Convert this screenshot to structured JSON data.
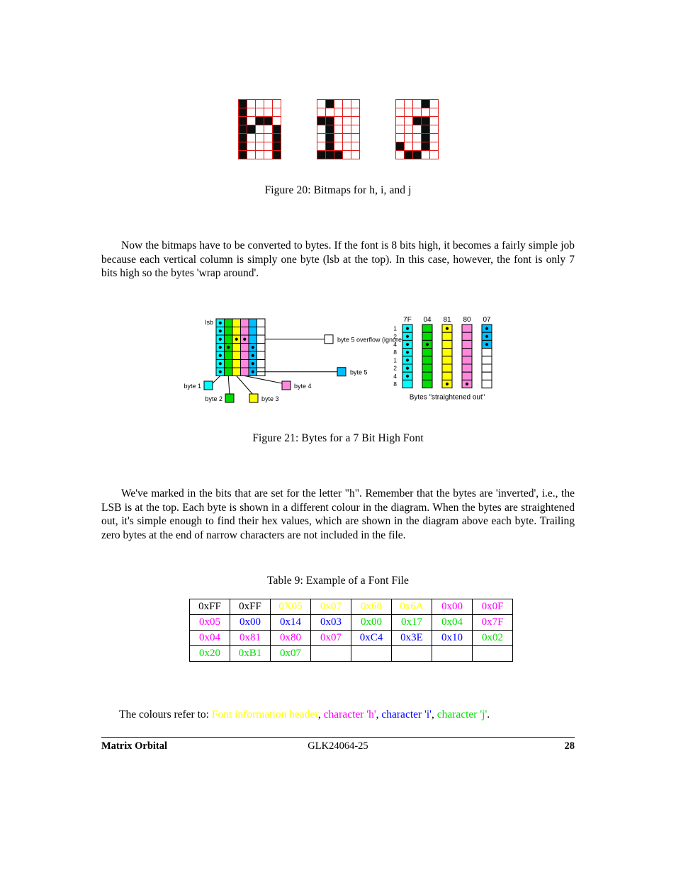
{
  "figure20": {
    "caption": "Figure 20: Bitmaps for h, i, and j",
    "grid_color": "#e01b1b",
    "on_color": "#0d0d0d",
    "bitmaps": [
      {
        "char": "h",
        "cols": 5,
        "rows": 7,
        "pixels": [
          [
            1,
            0,
            0,
            0,
            0
          ],
          [
            1,
            0,
            0,
            0,
            0
          ],
          [
            1,
            0,
            1,
            1,
            0
          ],
          [
            1,
            1,
            0,
            0,
            1
          ],
          [
            1,
            0,
            0,
            0,
            1
          ],
          [
            1,
            0,
            0,
            0,
            1
          ],
          [
            1,
            0,
            0,
            0,
            1
          ]
        ]
      },
      {
        "char": "i",
        "cols": 5,
        "rows": 7,
        "pixels": [
          [
            0,
            1,
            0,
            0,
            0
          ],
          [
            0,
            0,
            0,
            0,
            0
          ],
          [
            1,
            1,
            0,
            0,
            0
          ],
          [
            0,
            1,
            0,
            0,
            0
          ],
          [
            0,
            1,
            0,
            0,
            0
          ],
          [
            0,
            1,
            0,
            0,
            0
          ],
          [
            1,
            1,
            1,
            0,
            0
          ]
        ]
      },
      {
        "char": "j",
        "cols": 5,
        "rows": 7,
        "pixels": [
          [
            0,
            0,
            0,
            1,
            0
          ],
          [
            0,
            0,
            0,
            0,
            0
          ],
          [
            0,
            0,
            1,
            1,
            0
          ],
          [
            0,
            0,
            0,
            1,
            0
          ],
          [
            0,
            0,
            0,
            1,
            0
          ],
          [
            1,
            0,
            0,
            1,
            0
          ],
          [
            0,
            1,
            1,
            0,
            0
          ]
        ]
      }
    ]
  },
  "paragraphs": {
    "p1": "Now the bitmaps have to be converted to bytes. If the font is 8 bits high, it becomes a fairly simple job because each vertical column is simply one byte (lsb at the top). In this case, however, the font is only 7 bits high so the bytes 'wrap around'.",
    "p2": "We've marked in the bits that are set for the letter \"h\". Remember that the bytes are 'inverted', i.e., the LSB is at the top. Each byte is shown in a different colour in the diagram. When the bytes are straightened out, it's simple enough to find their hex values, which are shown in the diagram above each byte. Trailing zero bytes at the end of narrow characters are not included in the file."
  },
  "figure21": {
    "caption": "Figure 21: Bytes for a 7 Bit High Font",
    "lsb_label": "lsb",
    "straightened_label": "Bytes \"straightened out\"",
    "byte_colors": {
      "byte1": "#00ffff",
      "byte2": "#00dd00",
      "byte3": "#ffff00",
      "byte4": "#ff88dd",
      "byte5": "#00bfff",
      "overflow": "#ffffff"
    },
    "legend": [
      {
        "label": "byte 5 overflow (ignored)",
        "color": "#ffffff"
      },
      {
        "label": "byte 5",
        "color": "#00bfff"
      },
      {
        "label": "byte 1",
        "color": "#00ffff"
      },
      {
        "label": "byte 2",
        "color": "#00dd00"
      },
      {
        "label": "byte 3",
        "color": "#ffff00"
      },
      {
        "label": "byte 4",
        "color": "#ff88dd"
      }
    ],
    "wrapped_grid": {
      "cols": 6,
      "rows": 7,
      "column_colors": [
        "#00ffff",
        "#00dd00",
        "#ffff00",
        "#ff88dd",
        "#00bfff",
        "#ffffff"
      ],
      "dots": [
        [
          1,
          0,
          0,
          0,
          0,
          0
        ],
        [
          1,
          0,
          0,
          0,
          0,
          0
        ],
        [
          1,
          0,
          1,
          1,
          0,
          0
        ],
        [
          1,
          1,
          0,
          0,
          1,
          0
        ],
        [
          1,
          0,
          0,
          0,
          1,
          0
        ],
        [
          1,
          0,
          0,
          0,
          1,
          0
        ],
        [
          1,
          0,
          0,
          0,
          1,
          0
        ]
      ]
    },
    "straightened": {
      "weights": [
        "1",
        "2",
        "4",
        "8",
        "1",
        "2",
        "4",
        "8"
      ],
      "columns": [
        {
          "hex": "7F",
          "color": "#00ffff",
          "dots": [
            1,
            1,
            1,
            1,
            1,
            1,
            1,
            0
          ]
        },
        {
          "hex": "04",
          "color": "#00dd00",
          "dots": [
            0,
            0,
            1,
            0,
            0,
            0,
            0,
            0
          ]
        },
        {
          "hex": "81",
          "color": "#ffff00",
          "dots": [
            1,
            0,
            0,
            0,
            0,
            0,
            0,
            1
          ]
        },
        {
          "hex": "80",
          "color": "#ff88dd",
          "dots": [
            0,
            0,
            0,
            0,
            0,
            0,
            0,
            1
          ]
        },
        {
          "hex": "07",
          "color": "#00bfff",
          "dots": [
            1,
            1,
            1,
            0,
            0,
            0,
            0,
            0
          ]
        }
      ]
    }
  },
  "table9": {
    "caption": "Table 9: Example of a Font File",
    "rows": [
      [
        {
          "text": "0xFF",
          "cls": "c-black"
        },
        {
          "text": "0xFF",
          "cls": "c-black"
        },
        {
          "text": "0X05",
          "cls": "c-hdr"
        },
        {
          "text": "0x07",
          "cls": "c-hdr"
        },
        {
          "text": "0x68",
          "cls": "c-hdr"
        },
        {
          "text": "0x6A",
          "cls": "c-hdr"
        },
        {
          "text": "0x00",
          "cls": "c-h"
        },
        {
          "text": "0x0F",
          "cls": "c-h"
        }
      ],
      [
        {
          "text": "0x05",
          "cls": "c-h"
        },
        {
          "text": "0x00",
          "cls": "c-i"
        },
        {
          "text": "0x14",
          "cls": "c-i"
        },
        {
          "text": "0x03",
          "cls": "c-i"
        },
        {
          "text": "0x00",
          "cls": "c-j"
        },
        {
          "text": "0x17",
          "cls": "c-j"
        },
        {
          "text": "0x04",
          "cls": "c-j"
        },
        {
          "text": "0x7F",
          "cls": "c-h"
        }
      ],
      [
        {
          "text": "0x04",
          "cls": "c-h"
        },
        {
          "text": "0x81",
          "cls": "c-h"
        },
        {
          "text": "0x80",
          "cls": "c-h"
        },
        {
          "text": "0x07",
          "cls": "c-h"
        },
        {
          "text": "0xC4",
          "cls": "c-i"
        },
        {
          "text": "0x3E",
          "cls": "c-i"
        },
        {
          "text": "0x10",
          "cls": "c-i"
        },
        {
          "text": "0x02",
          "cls": "c-j"
        }
      ],
      [
        {
          "text": "0x20",
          "cls": "c-j"
        },
        {
          "text": "0xB1",
          "cls": "c-j"
        },
        {
          "text": "0x07",
          "cls": "c-j"
        },
        {
          "text": "",
          "cls": "c-black"
        },
        {
          "text": "",
          "cls": "c-black"
        },
        {
          "text": "",
          "cls": "c-black"
        },
        {
          "text": "",
          "cls": "c-black"
        },
        {
          "text": "",
          "cls": "c-black"
        }
      ]
    ]
  },
  "colour_note": {
    "intro": "The colours refer to: ",
    "items": [
      {
        "text": "Font information header",
        "color": "#ffff00"
      },
      {
        "text": "character 'h'",
        "color": "#ff00ff"
      },
      {
        "text": "character 'i'",
        "color": "#0000ff"
      },
      {
        "text": "character 'j'",
        "color": "#00e000"
      }
    ],
    "separator": ", ",
    "terminator": "."
  },
  "footer": {
    "left": "Matrix Orbital",
    "center": "GLK24064-25",
    "page": "28"
  }
}
